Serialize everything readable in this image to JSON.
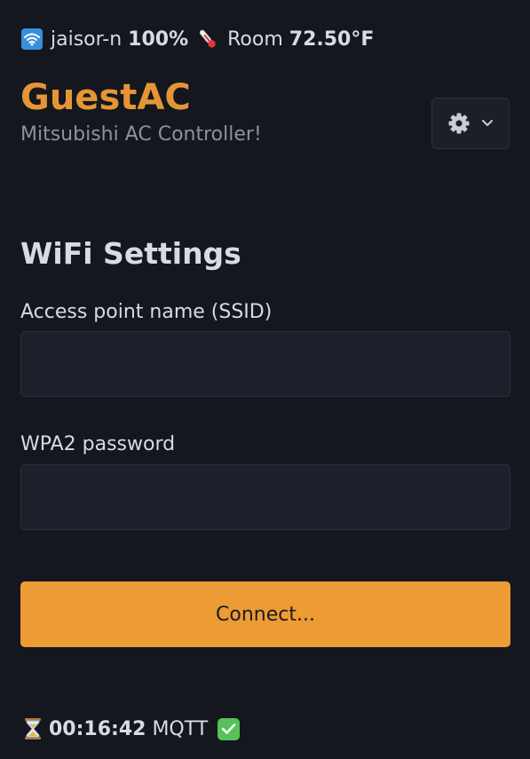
{
  "status": {
    "wifi_icon": "wifi-signal-icon",
    "ssid": "jaisor-n",
    "signal": "100%",
    "temp_icon": "thermometer-icon",
    "room_label": "Room",
    "room_temp": "72.50°F"
  },
  "header": {
    "title": "GuestAC",
    "subtitle": "Mitsubishi AC Controller!",
    "settings_icon": "gear-icon",
    "dropdown_icon": "chevron-down-icon"
  },
  "form": {
    "heading": "WiFi Settings",
    "ssid_label": "Access point name (SSID)",
    "ssid_value": "",
    "password_label": "WPA2 password",
    "password_value": "",
    "connect_label": "Connect..."
  },
  "footer": {
    "timer_icon": "hourglass-icon",
    "uptime": "00:16:42",
    "mqtt_label": "MQTT",
    "mqtt_status_icon": "check-mark-icon"
  },
  "colors": {
    "background": "#14171d",
    "accent": "#e59536",
    "button": "#ec9b35",
    "input_bg": "#1d212b",
    "wifi_badge": "#3a8fdc",
    "check_badge": "#58c15a"
  }
}
